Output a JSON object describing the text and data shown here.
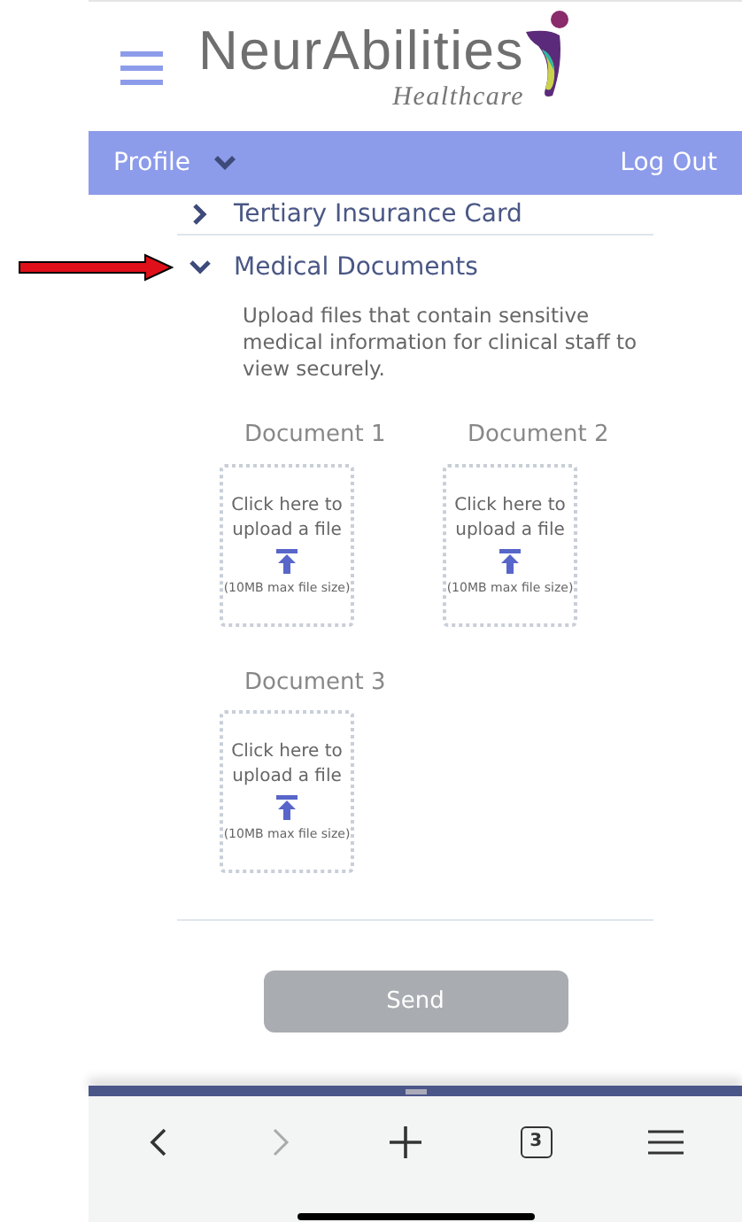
{
  "header": {
    "logo_title": "NeurAbilities",
    "logo_subtitle": "Healthcare"
  },
  "nav": {
    "profile": "Profile",
    "logout": "Log Out"
  },
  "sections": [
    {
      "title": "Tertiary Insurance Card",
      "expanded": false
    },
    {
      "title": "Medical Documents",
      "expanded": true
    }
  ],
  "description": "Upload files that contain sensitive medical information for clinical staff to view securely.",
  "documents": [
    {
      "label": "Document 1",
      "prompt": "Click here to upload a file",
      "limit": "(10MB max file size)"
    },
    {
      "label": "Document 2",
      "prompt": "Click here to upload a file",
      "limit": "(10MB max file size)"
    },
    {
      "label": "Document 3",
      "prompt": "Click here to upload a file",
      "limit": "(10MB max file size)"
    }
  ],
  "send_button": {
    "label": "Send",
    "disabled": true
  },
  "browser_toolbar": {
    "back_disabled": false,
    "forward_disabled": true,
    "tab_count": "3"
  }
}
